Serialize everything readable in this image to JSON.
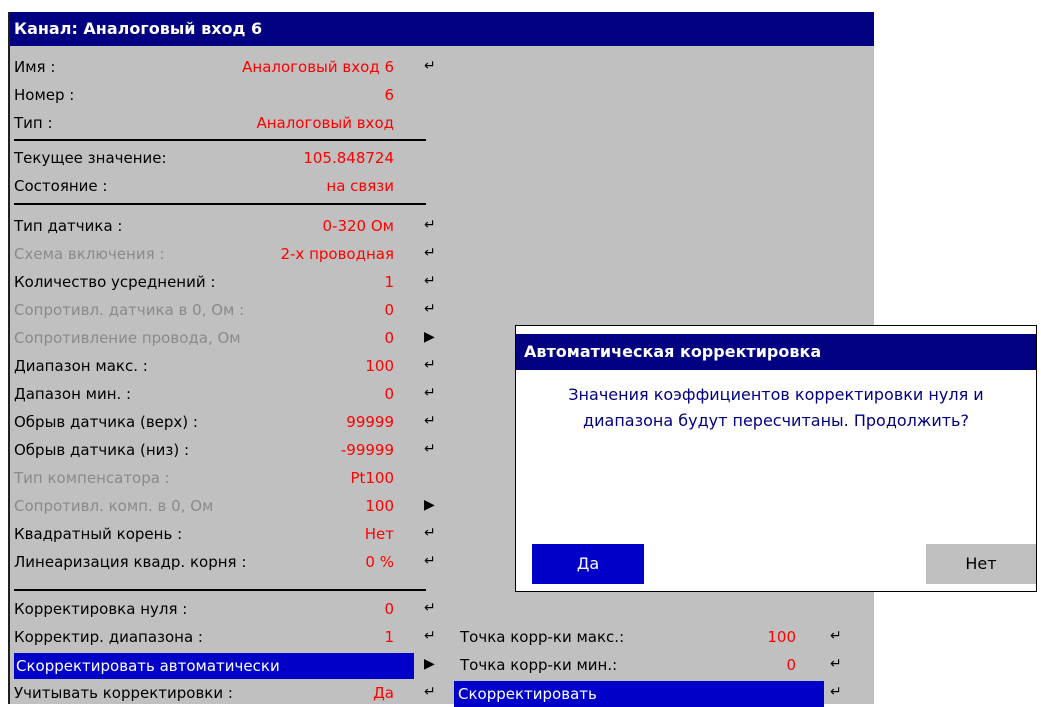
{
  "window": {
    "title": "Канал: Аналоговый вход 6"
  },
  "rows": {
    "name": {
      "label": "Имя :",
      "value": "Аналоговый вход 6"
    },
    "number": {
      "label": "Номер :",
      "value": "6"
    },
    "type": {
      "label": "Тип :",
      "value": "Аналоговый вход"
    },
    "current": {
      "label": "Текущее значение:",
      "value": "105.848724"
    },
    "state": {
      "label": "Состояние :",
      "value": "на связи"
    },
    "sensor_type": {
      "label": "Тип датчика :",
      "value": "0-320 Ом"
    },
    "wiring": {
      "label": "Схема включения :",
      "value": "2-х проводная"
    },
    "averaging": {
      "label": "Количество усреднений :",
      "value": "1"
    },
    "r0": {
      "label": "Сопротивл. датчика в 0, Ом :",
      "value": "0"
    },
    "wire_r": {
      "label": "Сопротивление провода, Ом",
      "value": "0"
    },
    "range_max": {
      "label": "Диапазон макс. :",
      "value": "100"
    },
    "range_min": {
      "label": "Дапазон мин. :",
      "value": "0"
    },
    "break_hi": {
      "label": "Обрыв датчика (верх) :",
      "value": "99999"
    },
    "break_lo": {
      "label": "Обрыв датчика (низ) :",
      "value": "-99999"
    },
    "comp_type": {
      "label": "Тип компенсатора :",
      "value": "Pt100"
    },
    "comp_r0": {
      "label": "Сопротивл. комп. в 0, Ом",
      "value": "100"
    },
    "sqrt": {
      "label": "Квадратный корень :",
      "value": "Нет"
    },
    "sqrt_lin": {
      "label": "Линеаризация квадр. корня :",
      "value": "0 %"
    },
    "zero_corr": {
      "label": "Корректировка нуля :",
      "value": "0"
    },
    "range_corr": {
      "label": "Корректир. диапазона :",
      "value": "1"
    },
    "auto_corr": {
      "label": "Скорректировать автоматически"
    },
    "use_corr": {
      "label": "Учитывать корректировки :",
      "value": "Да"
    }
  },
  "submenu": {
    "pt_max": {
      "label": "Точка корр-ки макс.:",
      "value": "100"
    },
    "pt_min": {
      "label": "Точка корр-ки мин.:",
      "value": "0"
    },
    "correct": {
      "label": "Скорректировать"
    }
  },
  "dialog": {
    "title": "Автоматическая корректировка",
    "message_line1": "Значения коэффициентов корректировки нуля и",
    "message_line2": "диапазона будут пересчитаны. Продолжить?",
    "yes": "Да",
    "no": "Нет"
  },
  "icons": {
    "enter": "↵",
    "submenu": "▶"
  },
  "colors": {
    "title_bar": "#000080",
    "value_text": "#ff0000",
    "highlight": "#0000c8",
    "disabled_text": "#8a8a8a",
    "panel": "#c0c0c0"
  }
}
